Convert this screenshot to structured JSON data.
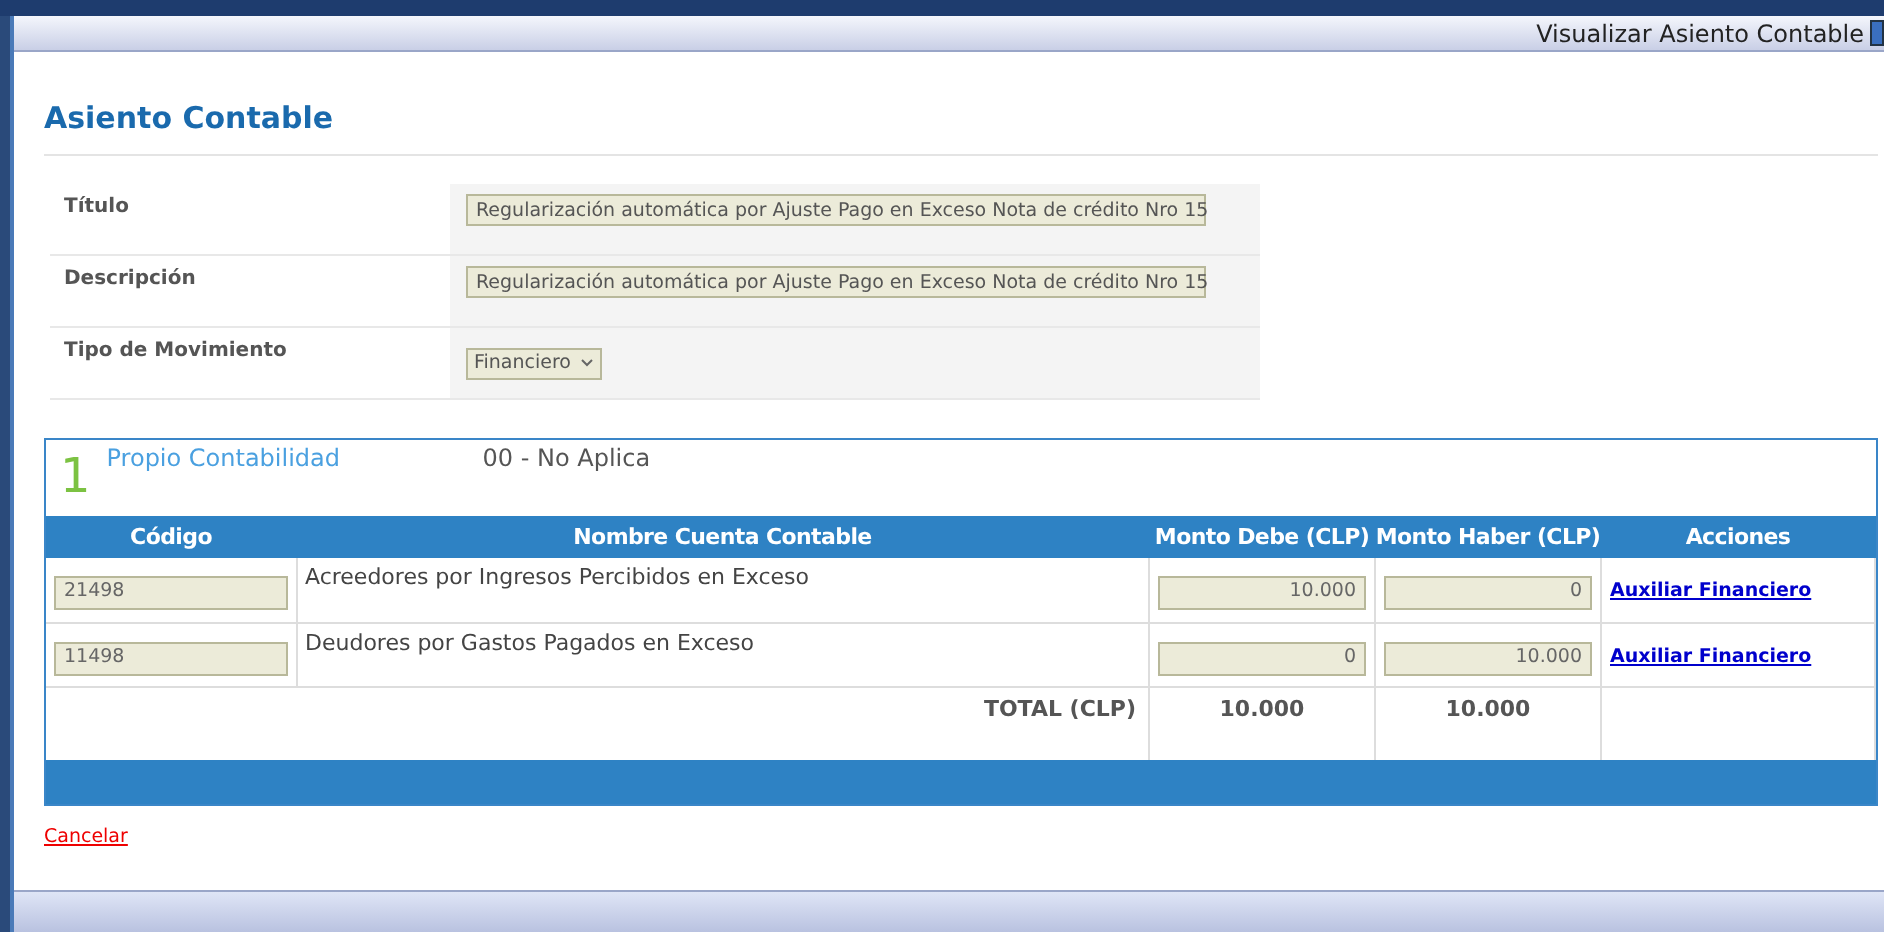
{
  "window": {
    "title": "Visualizar Asiento Contable"
  },
  "heading": "Asiento Contable",
  "form": [
    {
      "label": "Título",
      "kind": "text",
      "value": "Regularización automática por Ajuste Pago en Exceso Nota de crédito Nro 15"
    },
    {
      "label": "Descripción",
      "kind": "text",
      "value": "Regularización automática por Ajuste Pago en Exceso Nota de crédito Nro 15"
    },
    {
      "label": "Tipo de Movimiento",
      "kind": "select",
      "value": "Financiero"
    }
  ],
  "section": {
    "number": "1",
    "title": "Propio Contabilidad",
    "subtitle": "00 - No Aplica"
  },
  "table": {
    "columns": [
      "Código",
      "Nombre Cuenta Contable",
      "Monto Debe (CLP)",
      "Monto Haber (CLP)",
      "Acciones"
    ],
    "rows": [
      {
        "code": "21498",
        "name": "Acreedores por Ingresos Percibidos en Exceso",
        "debe": "10.000",
        "haber": "0",
        "action": "Auxiliar Financiero"
      },
      {
        "code": "11498",
        "name": "Deudores por Gastos Pagados en Exceso",
        "debe": "0",
        "haber": "10.000",
        "action": "Auxiliar Financiero"
      }
    ],
    "total": {
      "label": "TOTAL (CLP)",
      "debe": "10.000",
      "haber": "10.000"
    }
  },
  "cancel": "Cancelar"
}
